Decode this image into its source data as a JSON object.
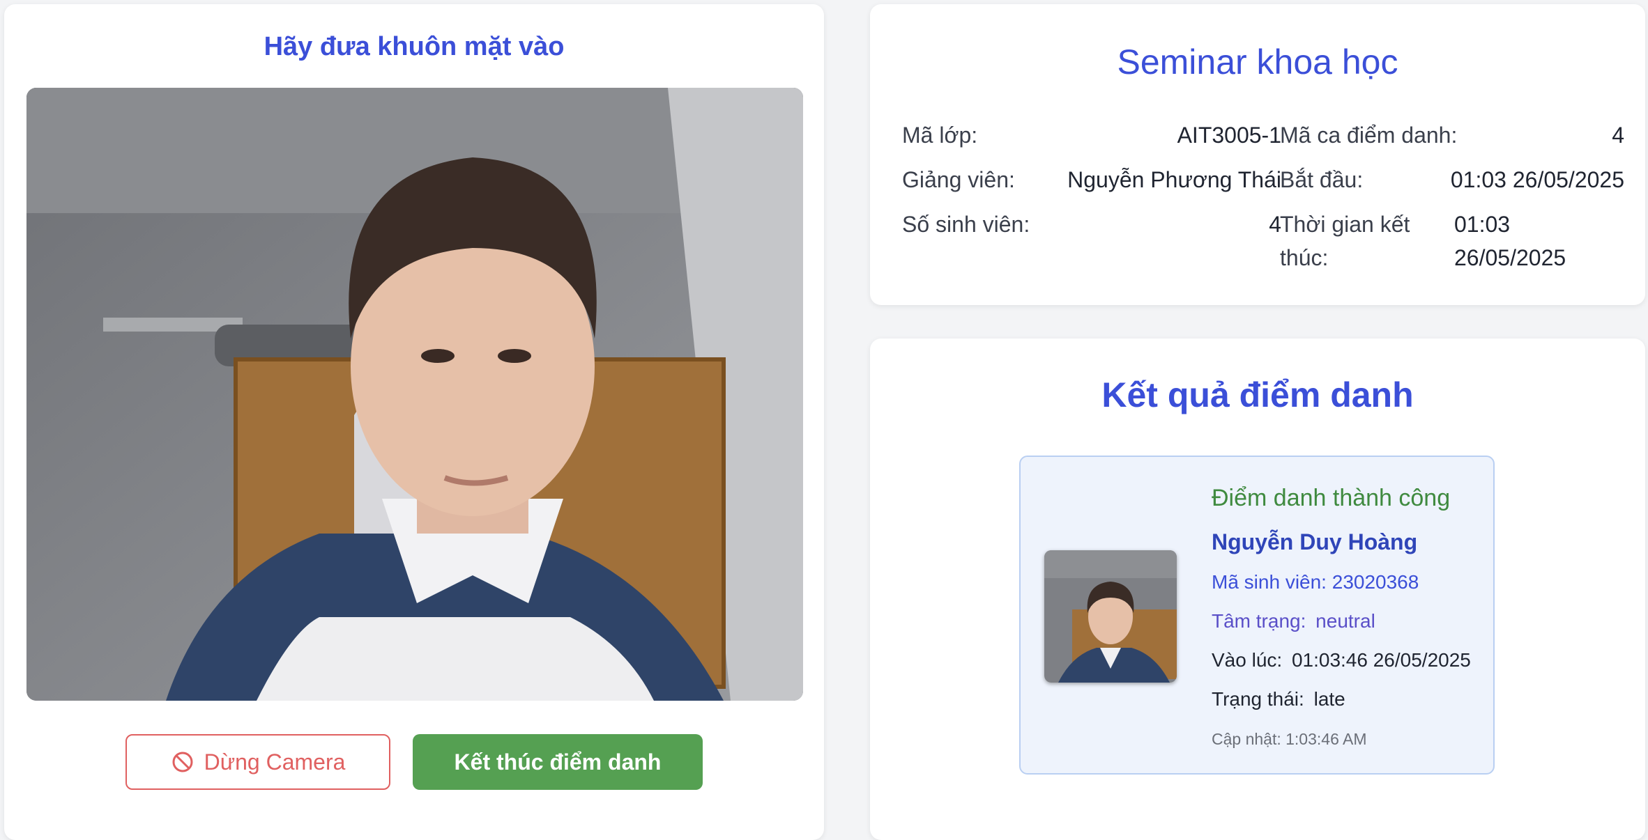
{
  "camera": {
    "title": "Hãy đưa khuôn mặt vào",
    "stop_button": "Dừng Camera",
    "end_button": "Kết thúc điểm danh"
  },
  "session": {
    "title": "Seminar khoa học",
    "class_code_label": "Mã lớp:",
    "class_code": "AIT3005-1",
    "lecturer_label": "Giảng viên:",
    "lecturer": "Nguyễn Phương Thái",
    "students_label": "Số sinh viên:",
    "students": "4",
    "shift_code_label": "Mã ca điểm danh:",
    "shift_code": "4",
    "start_label": "Bắt đầu:",
    "start": "01:03 26/05/2025",
    "end_label_1": "Thời gian kết",
    "end_label_2": "thúc:",
    "end_1": "01:03",
    "end_2": "26/05/2025"
  },
  "result": {
    "title": "Kết quả điểm danh",
    "status_message": "Điểm danh thành công",
    "name": "Nguyễn Duy Hoàng",
    "student_id_label": "Mã sinh viên:",
    "student_id": "23020368",
    "mood_label": "Tâm trạng:",
    "mood": "neutral",
    "time_label": "Vào lúc:",
    "time": "01:03:46 26/05/2025",
    "state_label": "Trạng thái:",
    "state": "late",
    "updated": "Cập nhật: 1:03:46 AM"
  },
  "icons": {
    "stop": "ban-icon"
  },
  "colors": {
    "accent": "#3b4fd8",
    "success": "#55a052",
    "danger": "#e06060",
    "success_text": "#3f8a3f"
  }
}
